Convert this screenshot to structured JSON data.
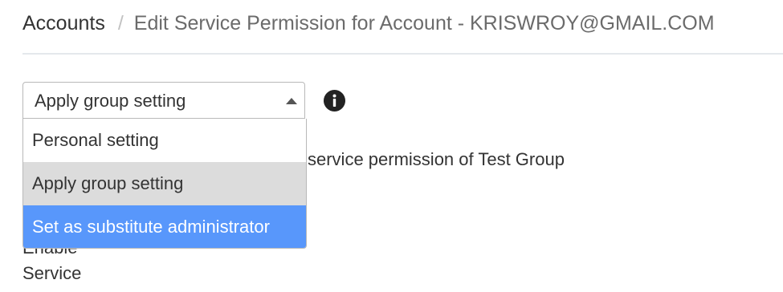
{
  "breadcrumb": {
    "root": "Accounts",
    "separator": "/",
    "current": "Edit Service Permission for Account - KRISWROY@GMAIL.COM"
  },
  "permission_select": {
    "value": "Apply group setting",
    "options": [
      {
        "label": "Personal setting",
        "state": "normal"
      },
      {
        "label": "Apply group setting",
        "state": "selected"
      },
      {
        "label": "Set as substitute administrator",
        "state": "highlighted"
      }
    ]
  },
  "icons": {
    "info": "info-icon",
    "caret": "caret-up-icon"
  },
  "content": {
    "group_permission_text": "service permission of Test Group",
    "enable_label": "Enable",
    "service_label": "Service"
  },
  "colors": {
    "highlight": "#5897fb",
    "selected": "#dcdcdc"
  }
}
